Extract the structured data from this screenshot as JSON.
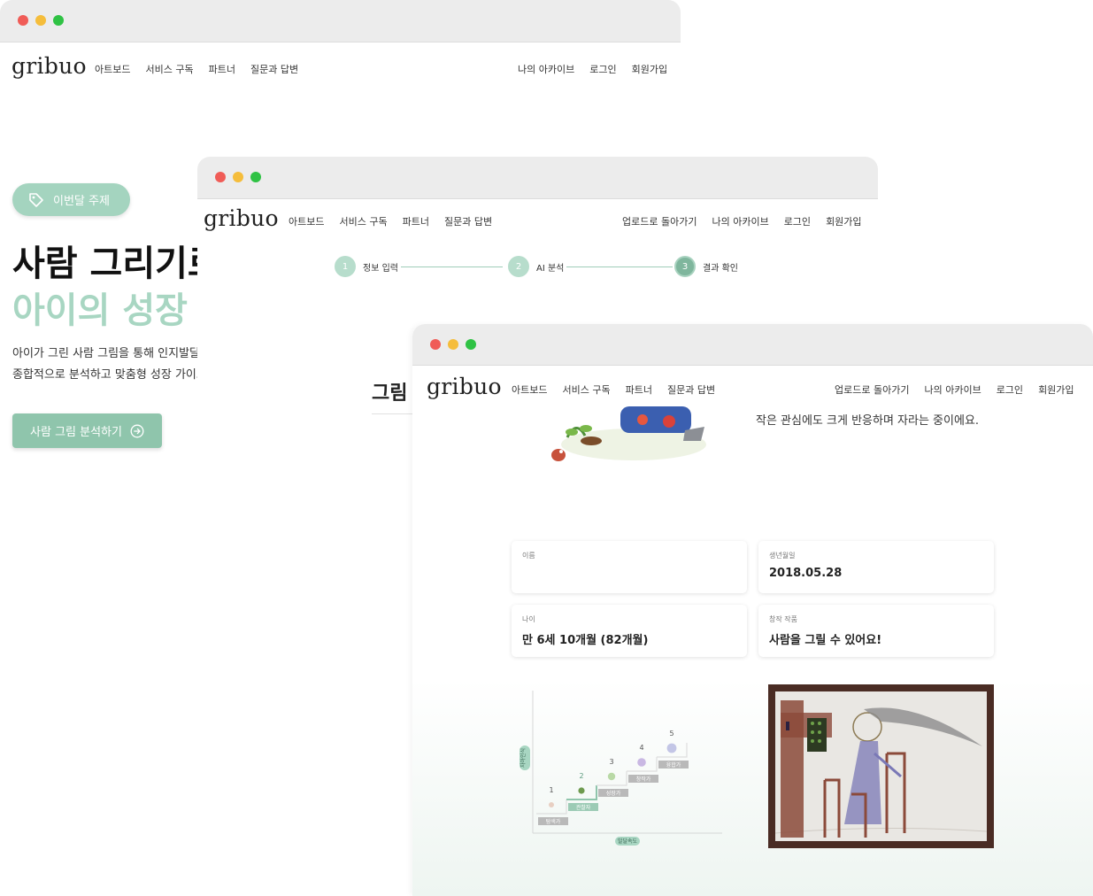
{
  "window1": {
    "logo": "gribuo",
    "nav_left": [
      "아트보드",
      "서비스 구독",
      "파트너",
      "질문과 답변"
    ],
    "nav_right": [
      "나의 아카이브",
      "로그인",
      "회원가입"
    ],
    "topic_pill": "이번달 주제",
    "hero_line1": "사람 그리기로",
    "hero_line2": "아이의 성장",
    "hero_desc_line1": "아이가 그린 사람 그림을 통해 인지발달",
    "hero_desc_line2": "종합적으로 분석하고 맞춤형 성장 가이드",
    "cta_label": "사람 그림 분석하기"
  },
  "window2": {
    "logo": "gribuo",
    "nav_left": [
      "아트보드",
      "서비스 구독",
      "파트너",
      "질문과 답변"
    ],
    "nav_right": [
      "업로드로 돌아가기",
      "나의 아카이브",
      "로그인",
      "회원가입"
    ],
    "steps": [
      {
        "num": "1",
        "label": "정보 입력"
      },
      {
        "num": "2",
        "label": "AI 분석"
      },
      {
        "num": "3",
        "label": "결과 확인"
      }
    ],
    "heading": "그림"
  },
  "window3": {
    "logo": "gribuo",
    "nav_left": [
      "아트보드",
      "서비스 구독",
      "파트너",
      "질문과 답변"
    ],
    "nav_right": [
      "업로드로 돌아가기",
      "나의 아카이브",
      "로그인",
      "회원가입"
    ],
    "clipped_text": "작은 관심에도 크게 반응하며 자라는 중이에요.",
    "fields": {
      "name": {
        "label": "이름",
        "value": ""
      },
      "birthdate": {
        "label": "생년월일",
        "value": "2018.05.28"
      },
      "age": {
        "label": "나이",
        "value": "만 6세 10개월 (82개월)"
      },
      "work": {
        "label": "창작 작품",
        "value": "사람을 그릴 수 있어요!"
      }
    },
    "growth_chart": {
      "y_label": "자아인식",
      "x_label": "발달속도",
      "steps": [
        {
          "num": "1",
          "label": "탐색가"
        },
        {
          "num": "2",
          "label": "관찰자"
        },
        {
          "num": "3",
          "label": "성장가"
        },
        {
          "num": "4",
          "label": "창작가"
        },
        {
          "num": "5",
          "label": "융합가"
        }
      ],
      "current_step": 2
    }
  },
  "colors": {
    "accent": "#8fc5ac",
    "accent_light": "#a8d6c2",
    "frame": "#4a2c24"
  }
}
